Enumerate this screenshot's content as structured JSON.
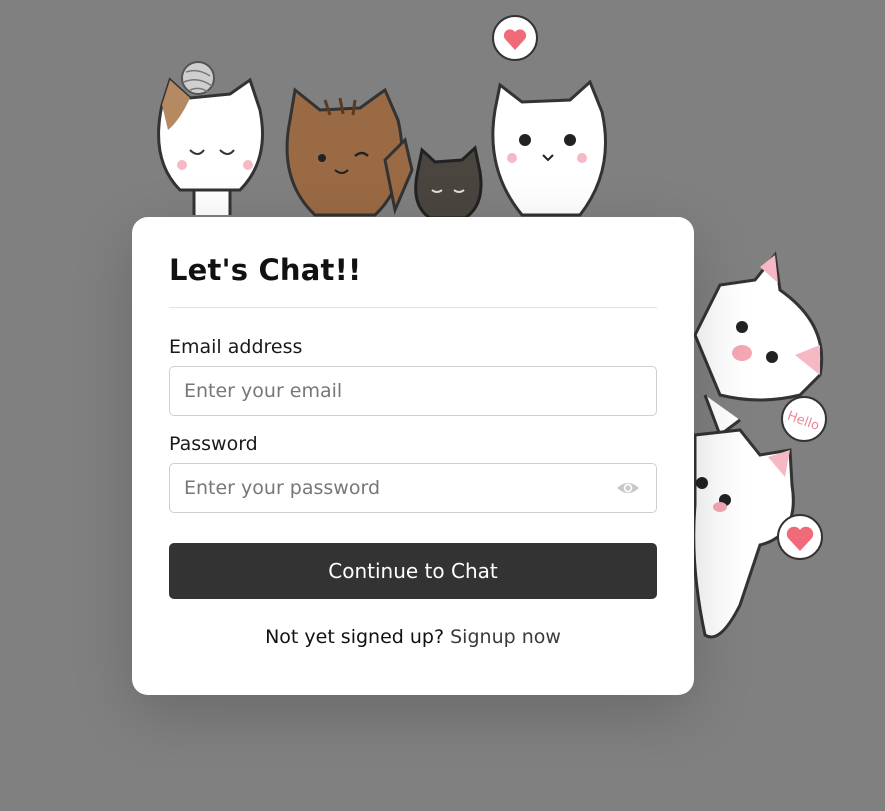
{
  "card": {
    "title": "Let's Chat!!"
  },
  "email": {
    "label": "Email address",
    "placeholder": "Enter your email",
    "value": ""
  },
  "password": {
    "label": "Password",
    "placeholder": "Enter your password",
    "value": "",
    "toggle_icon": "eye-icon"
  },
  "submit": {
    "label": "Continue to Chat"
  },
  "footer": {
    "prompt": "Not yet signed up?",
    "link": "Signup now"
  },
  "illustration": {
    "bubble_text": "Hello",
    "icons": [
      "cat-illustration",
      "heart-icon"
    ]
  },
  "colors": {
    "background": "#808080",
    "card": "#ffffff",
    "button": "#333333",
    "heart": "#f06a7a",
    "cat_pink": "#f6b8c4"
  }
}
